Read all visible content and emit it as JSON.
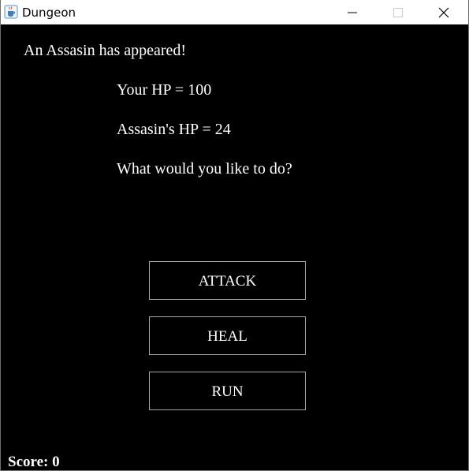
{
  "window": {
    "title": "Dungeon",
    "app_icon": "java-coffee-cup-icon",
    "controls": [
      "minimize-icon",
      "maximize-icon",
      "close-icon"
    ]
  },
  "game": {
    "intro": "An Assasin has appeared!",
    "player_hp": "Your HP = 100",
    "enemy_hp": "Assasin's HP = 24",
    "prompt": "What would you like to do?",
    "actions": {
      "attack": "ATTACK",
      "heal": "HEAL",
      "run": "RUN"
    },
    "score_label": "Score: 0"
  },
  "colors": {
    "background": "#000000",
    "text": "#ffffff",
    "button_border": "#a7a7a7",
    "titlebar": "#ffffff"
  }
}
